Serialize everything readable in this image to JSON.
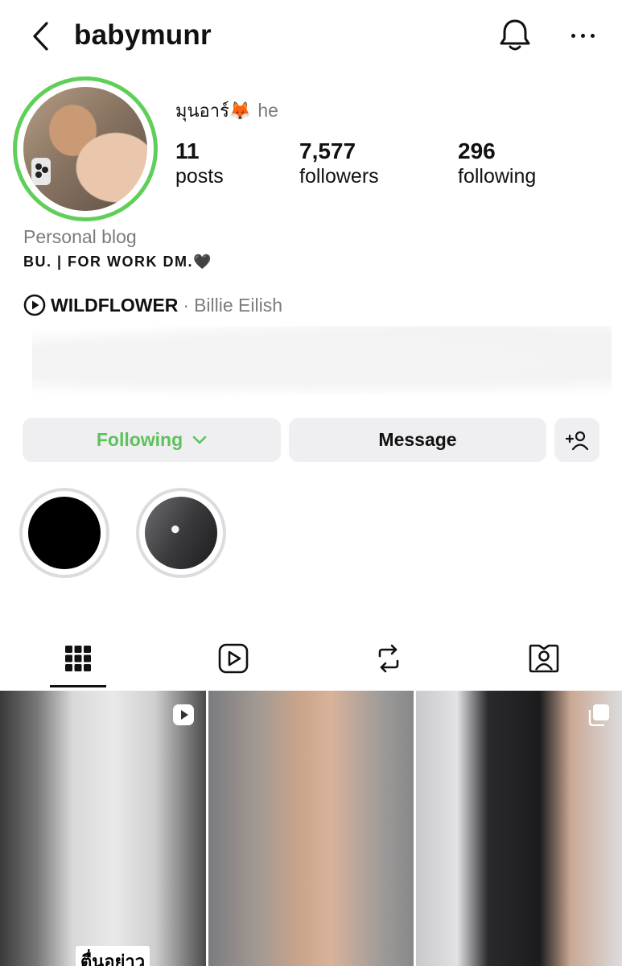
{
  "header": {
    "username": "babymunr",
    "icons": {
      "back": "chevron-left-icon",
      "notifications": "bell-icon",
      "more": "more-horizontal-icon"
    }
  },
  "profile": {
    "display_name": "มุนอาร์🦊",
    "pronoun": "he",
    "avatar_ring_color": "#5fcf5a",
    "stats": [
      {
        "number": "11",
        "label": "posts"
      },
      {
        "number": "7,577",
        "label": "followers"
      },
      {
        "number": "296",
        "label": "following"
      }
    ],
    "category": "Personal blog",
    "bio": "BU. | FOR WORK DM.🖤",
    "music": {
      "title": "WILDFLOWER",
      "separator": "·",
      "artist": "Billie Eilish"
    }
  },
  "actions": {
    "following_label": "Following",
    "following_color": "#5cc25a",
    "message_label": "Message",
    "add_user_icon": "add-user-icon"
  },
  "highlights": [
    {
      "name": "highlight-1"
    },
    {
      "name": "highlight-2"
    }
  ],
  "tabs": [
    {
      "name": "posts-grid",
      "icon": "grid-icon",
      "active": true
    },
    {
      "name": "reels",
      "icon": "reels-icon",
      "active": false
    },
    {
      "name": "reposts",
      "icon": "repost-icon",
      "active": false
    },
    {
      "name": "tagged",
      "icon": "tagged-user-icon",
      "active": false
    }
  ],
  "grid": {
    "posts": [
      {
        "type": "reel",
        "badge_icon": "reel-badge-icon",
        "caption": "ตื่นอย่าว"
      },
      {
        "type": "photo"
      },
      {
        "type": "carousel",
        "badge_icon": "carousel-badge-icon"
      }
    ]
  }
}
